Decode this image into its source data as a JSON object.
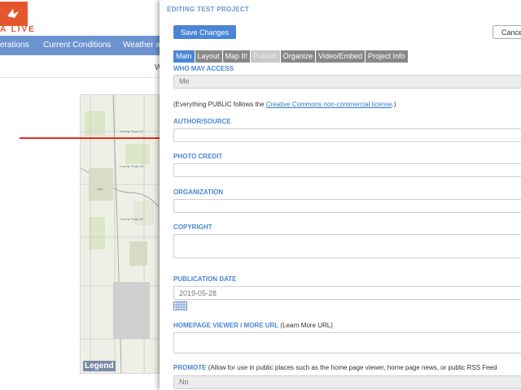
{
  "background": {
    "logo_text": "A LIVE",
    "nav": [
      "erations",
      "Current Conditions",
      "Weather a"
    ],
    "partial_letter": "W",
    "map_legend": "Legend",
    "map_labels": [
      "Yolo",
      "County Road 16",
      "County Road 18",
      "County Road 20"
    ]
  },
  "panel": {
    "title": "EDITING TEST PROJECT",
    "save_label": "Save Changes",
    "cancel_label": "Cance",
    "tabs": [
      "Main",
      "Layout",
      "Map It!",
      "Publish",
      "Organize",
      "Video/Embed",
      "Project Info"
    ],
    "who_may_access": {
      "label": "WHO MAY ACCESS",
      "value": "Me"
    },
    "public_note": {
      "prefix": "(Everything PUBLIC follows the ",
      "link": "Creative Commons non-commercial license",
      "suffix": ".)"
    },
    "author_source": {
      "label": "AUTHOR/SOURCE",
      "value": ""
    },
    "photo_credit": {
      "label": "PHOTO CREDIT",
      "value": ""
    },
    "organization": {
      "label": "ORGANIZATION",
      "value": ""
    },
    "copyright": {
      "label": "COPYRIGHT",
      "value": ""
    },
    "publication_date": {
      "label": "PUBLICATION DATE",
      "value": "2019-05-28"
    },
    "homepage_viewer": {
      "label": "HOMEPAGE VIEWER / MORE URL",
      "hint": " (Learn More URL)",
      "value": ""
    },
    "promote": {
      "label": "PROMOTE",
      "hint": " (Allow for use in public places such as the home page viewer, home page news, or public RSS Feed",
      "value": "No"
    }
  },
  "colors": {
    "accent": "#4a86d5",
    "nav": "#6c93cf",
    "brand": "#e4572e",
    "arrow": "#e0301e"
  }
}
